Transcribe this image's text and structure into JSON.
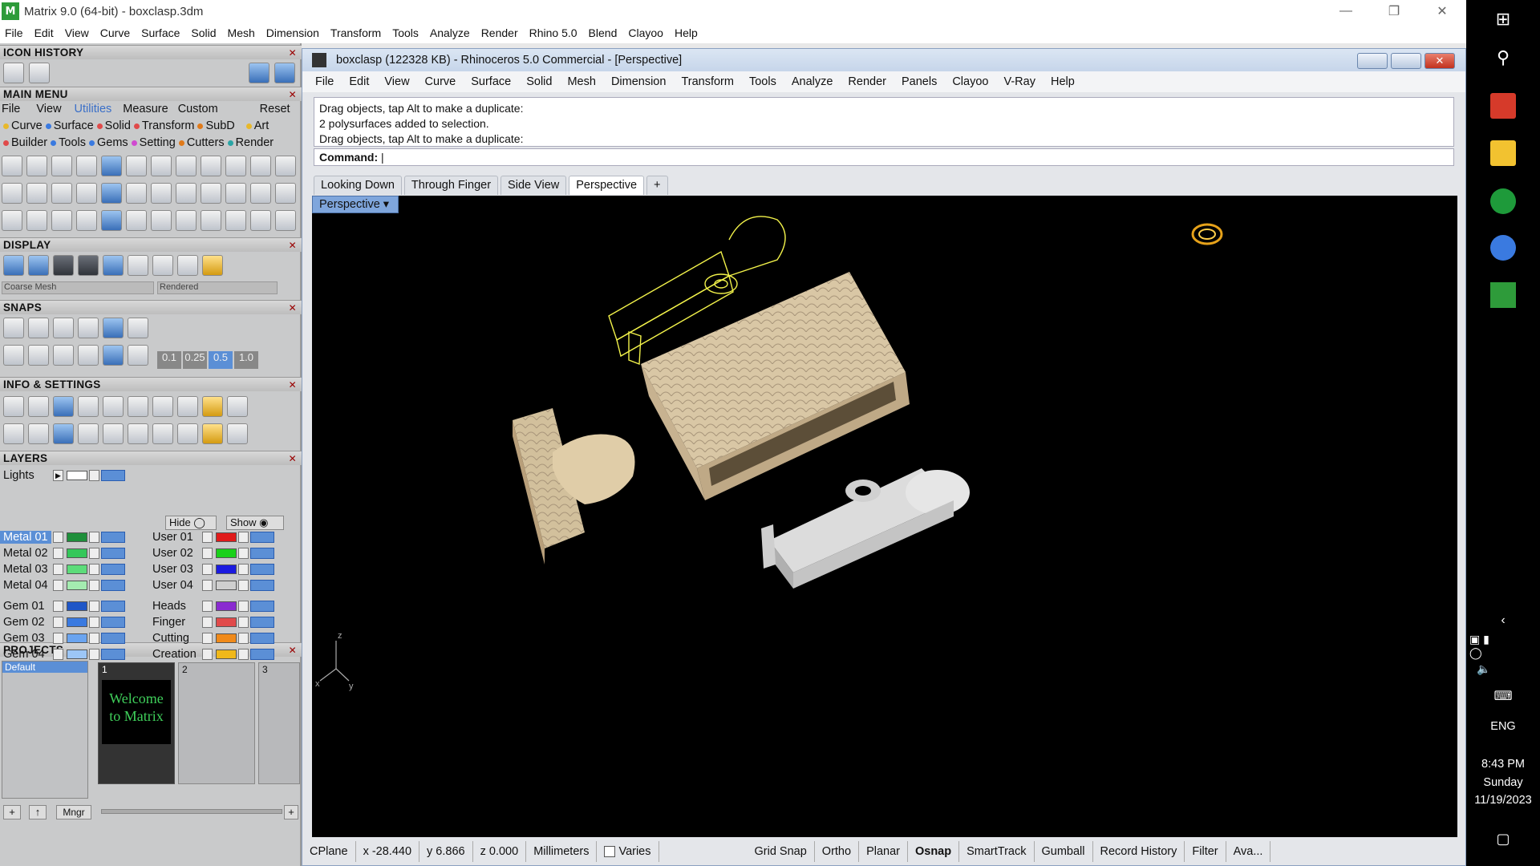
{
  "window": {
    "title": "Matrix 9.0 (64-bit) - boxclasp.3dm",
    "app_icon": "matrix-app-icon"
  },
  "outer_menu": [
    "File",
    "Edit",
    "View",
    "Curve",
    "Surface",
    "Solid",
    "Mesh",
    "Dimension",
    "Transform",
    "Tools",
    "Analyze",
    "Render",
    "Rhino 5.0",
    "Blend",
    "Clayoo",
    "Help"
  ],
  "left": {
    "icon_history": "ICON HISTORY",
    "main_menu": "MAIN MENU",
    "mm_tabs": [
      "File",
      "View",
      "Utilities",
      "Measure",
      "Custom",
      "Reset"
    ],
    "mm_row1": [
      "Curve",
      "Surface",
      "Solid",
      "Transform",
      "SubD",
      "Art"
    ],
    "mm_row2": [
      "Builder",
      "Tools",
      "Gems",
      "Setting",
      "Cutters",
      "Render"
    ],
    "display": "DISPLAY",
    "display_mesh": "Coarse Mesh",
    "display_mode": "Rendered",
    "snaps": "SNAPS",
    "snap_values": [
      "0.1",
      "0.25",
      "0.5",
      "1.0"
    ],
    "info_settings": "INFO & SETTINGS",
    "layers": "LAYERS",
    "lights": "Lights",
    "hide": "Hide",
    "show": "Show",
    "layers_left": [
      {
        "name": "Metal 01",
        "color": "#1e8f3a",
        "selected": true
      },
      {
        "name": "Metal 02",
        "color": "#34c75a"
      },
      {
        "name": "Metal 03",
        "color": "#5cdc7a"
      },
      {
        "name": "Metal 04",
        "color": "#a4ebb0"
      },
      {
        "name": "Gem 01",
        "color": "#1f56c7"
      },
      {
        "name": "Gem 02",
        "color": "#3a7ae0"
      },
      {
        "name": "Gem 03",
        "color": "#6aa4f0"
      },
      {
        "name": "Gem 04",
        "color": "#9cc6f6"
      }
    ],
    "layers_right": [
      {
        "name": "User 01",
        "color": "#e01b1b"
      },
      {
        "name": "User 02",
        "color": "#1ad11a"
      },
      {
        "name": "User 03",
        "color": "#1a1ae0"
      },
      {
        "name": "User 04",
        "color": "#cfcfcf"
      },
      {
        "name": "Heads",
        "color": "#8a2bd0"
      },
      {
        "name": "Finger",
        "color": "#e04a4a"
      },
      {
        "name": "Cutting",
        "color": "#f08a1a"
      },
      {
        "name": "Creation",
        "color": "#f0b81a"
      }
    ],
    "projects": "PROJECTS",
    "project_default": "Default",
    "slot_numbers": [
      "1",
      "2",
      "3"
    ],
    "welcome_text": "Welcome to Matrix",
    "mngr": "Mngr"
  },
  "rhino": {
    "title": "boxclasp (122328 KB) - Rhinoceros 5.0 Commercial - [Perspective]",
    "menu": [
      "File",
      "Edit",
      "View",
      "Curve",
      "Surface",
      "Solid",
      "Mesh",
      "Dimension",
      "Transform",
      "Tools",
      "Analyze",
      "Render",
      "Panels",
      "Clayoo",
      "V-Ray",
      "Help"
    ],
    "history": [
      "Drag objects, tap Alt to make a duplicate:",
      "2 polysurfaces added to selection.",
      "Drag objects, tap Alt to make a duplicate:"
    ],
    "command_label": "Command:",
    "tabs": [
      "Looking Down",
      "Through Finger",
      "Side View",
      "Perspective"
    ],
    "active_tab": "Perspective",
    "viewport_label": "Perspective",
    "axes": {
      "x": "x",
      "y": "y",
      "z": "z"
    },
    "status": [
      "CPlane",
      "x -28.440",
      "y 6.866",
      "z 0.000",
      "Millimeters",
      "Varies",
      "Grid Snap",
      "Ortho",
      "Planar",
      "Osnap",
      "SmartTrack",
      "Gumball",
      "Record History",
      "Filter",
      "Ava..."
    ]
  },
  "taskbar": {
    "lang": "ENG",
    "time": "8:43 PM",
    "day": "Sunday",
    "date": "11/19/2023"
  }
}
